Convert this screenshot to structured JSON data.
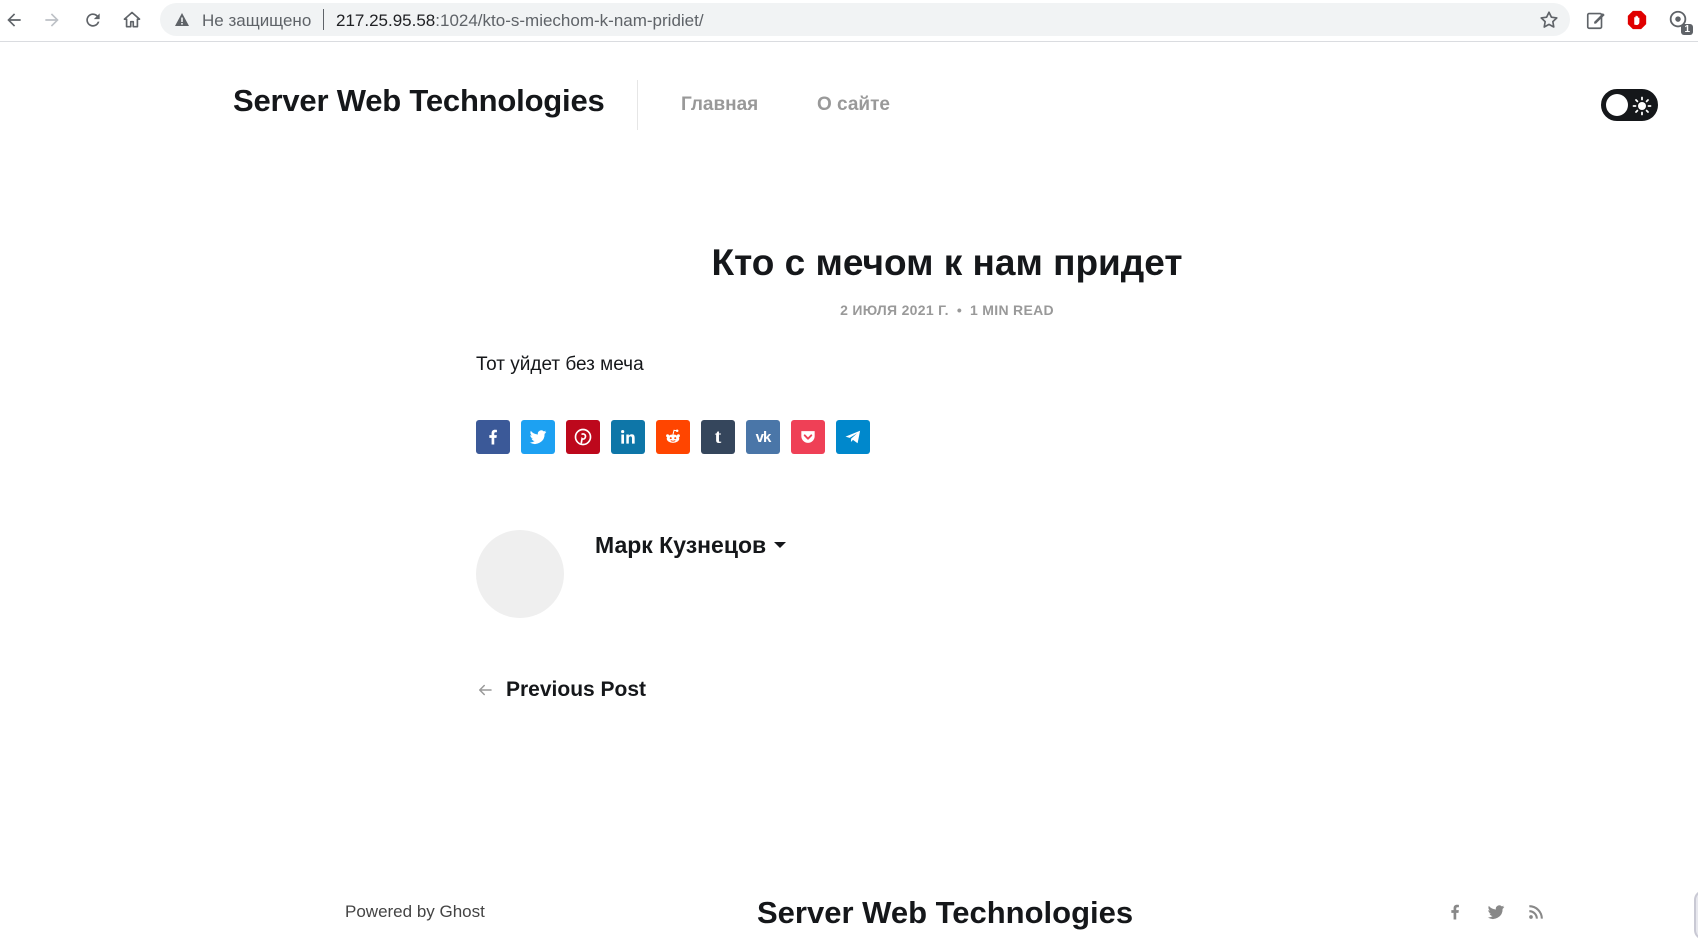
{
  "browser": {
    "insecure_label": "Не защищено",
    "url_host": "217.25.95.58",
    "url_path": ":1024/kto-s-miechom-k-nam-pridiet/",
    "extension_badge": "1"
  },
  "header": {
    "site_title": "Server Web Technologies",
    "nav": [
      {
        "label": "Главная"
      },
      {
        "label": "О сайте"
      }
    ]
  },
  "post": {
    "title": "Кто с мечом к нам придет",
    "date": "2 ИЮЛЯ 2021 Г.",
    "meta_separator": "•",
    "read_time": "1 MIN READ",
    "body": "Тот уйдет без меча"
  },
  "share": {
    "buttons": [
      {
        "name": "facebook",
        "color": "#3b5998",
        "icon": "facebook-icon"
      },
      {
        "name": "twitter",
        "color": "#1da1f2",
        "icon": "twitter-icon"
      },
      {
        "name": "pinterest",
        "color": "#bd081c",
        "icon": "pinterest-icon"
      },
      {
        "name": "linkedin",
        "color": "#0e76a8",
        "icon": "linkedin-icon"
      },
      {
        "name": "reddit",
        "color": "#ff4500",
        "icon": "reddit-icon"
      },
      {
        "name": "tumblr",
        "color": "#35465c",
        "icon": "tumblr-icon"
      },
      {
        "name": "vk",
        "color": "#4a76a8",
        "icon": "vk-icon"
      },
      {
        "name": "pocket",
        "color": "#ef4056",
        "icon": "pocket-icon"
      },
      {
        "name": "telegram",
        "color": "#0088cc",
        "icon": "telegram-icon"
      }
    ],
    "labels": {
      "tumblr": "t",
      "vk": "vk"
    }
  },
  "author": {
    "name": "Марк Кузнецов"
  },
  "navigation": {
    "previous_label": "Previous Post"
  },
  "footer": {
    "powered_by": "Powered by Ghost",
    "site_title": "Server Web Technologies",
    "social": [
      "facebook-icon",
      "twitter-icon",
      "rss-icon"
    ]
  },
  "colors": {
    "text": "#15171a",
    "muted": "#999999",
    "avatar_bg": "#efefef"
  }
}
